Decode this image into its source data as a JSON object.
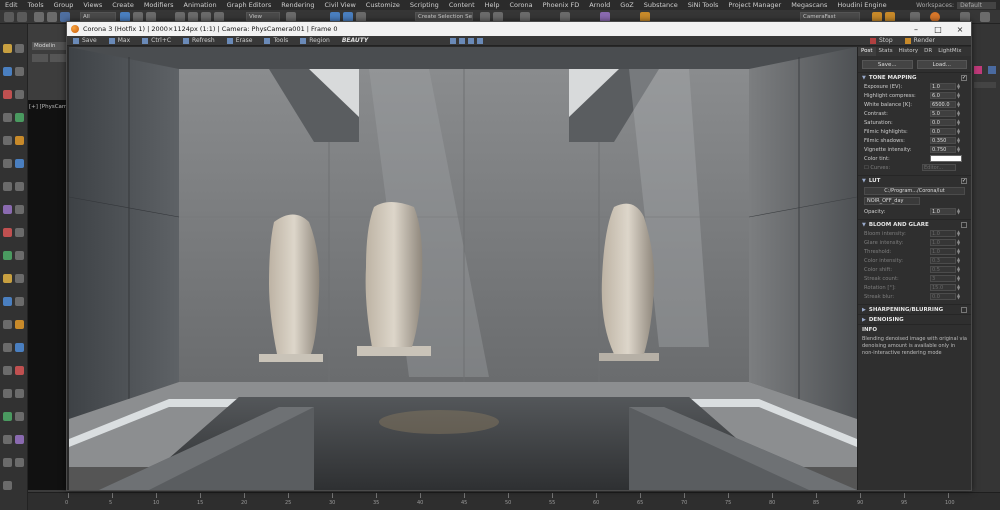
{
  "menubar": {
    "items": [
      "Edit",
      "Tools",
      "Group",
      "Views",
      "Create",
      "Modifiers",
      "Animation",
      "Graph Editors",
      "Rendering",
      "Civil View",
      "Customize",
      "Scripting",
      "Content",
      "Help",
      "Corona",
      "Phoenix FD",
      "Arnold",
      "GoZ",
      "Substance",
      "SiNi Tools",
      "Project Manager",
      "Megascans",
      "Houdini Engine"
    ],
    "workspaces_label": "Workspaces:",
    "workspaces_value": "Default"
  },
  "toolbar": {
    "filter_value": "All",
    "view_value": "View",
    "selection_set": "Create Selection Set",
    "camera_value": "CameraFast"
  },
  "left": {
    "modeling_tab": "Modelin",
    "viewport_label": "[+] [PhysCam"
  },
  "vfb": {
    "title": "Corona 3 (Hotfix 1) | 2000×1124px (1:1) | Camera: PhysCamera001 | Frame 0",
    "toolbar": [
      "Save",
      "Max",
      "Ctrl+C",
      "Refresh",
      "Erase",
      "Tools",
      "Region"
    ],
    "beauty": "BEAUTY",
    "right_toolbar": [
      "Stop",
      "Render"
    ]
  },
  "post": {
    "tabs": [
      "Post",
      "Stats",
      "History",
      "DR",
      "LightMix"
    ],
    "save_btn": "Save...",
    "load_btn": "Load...",
    "tone_mapping": {
      "title": "TONE MAPPING",
      "rows": [
        {
          "label": "Exposure (EV):",
          "value": "1.0"
        },
        {
          "label": "Highlight compress:",
          "value": "6.0"
        },
        {
          "label": "White balance [K]:",
          "value": "6500.0"
        },
        {
          "label": "Contrast:",
          "value": "5.0"
        },
        {
          "label": "Saturation:",
          "value": "0.0"
        },
        {
          "label": "Filmic highlights:",
          "value": "0.0"
        },
        {
          "label": "Filmic shadows:",
          "value": "0.350"
        },
        {
          "label": "Vignette intensity:",
          "value": "0.750"
        }
      ],
      "color_tint": "Color tint:",
      "curves": "Curves:",
      "curves_btn": "Editor..."
    },
    "lut": {
      "title": "LUT",
      "path": "C:/Program.../Corona/lut",
      "selected": "NOIR_OFF_day",
      "opacity_label": "Opacity:",
      "opacity_value": "1.0"
    },
    "bloom": {
      "title": "BLOOM AND GLARE",
      "rows": [
        {
          "label": "Bloom intensity:",
          "value": "1.0"
        },
        {
          "label": "Glare intensity:",
          "value": "1.0"
        },
        {
          "label": "Threshold:",
          "value": "1.0"
        },
        {
          "label": "Color intensity:",
          "value": "0.3"
        },
        {
          "label": "Color shift:",
          "value": "0.5"
        },
        {
          "label": "Streak count:",
          "value": "3"
        },
        {
          "label": "Rotation [°]:",
          "value": "15.0"
        },
        {
          "label": "Streak blur:",
          "value": "0.0"
        }
      ]
    },
    "sharpening_title": "SHARPENING/BLURRING",
    "denoising_title": "DENOISING",
    "info_title": "INFO",
    "info_text": "Blending denoised image with original via denoising amount is available only in non-interactive rendering mode"
  },
  "timeline": {
    "labels": [
      "0",
      "5",
      "10",
      "15",
      "20",
      "25",
      "30",
      "35",
      "40",
      "45",
      "50",
      "55",
      "60",
      "65",
      "70",
      "75",
      "80",
      "85",
      "90",
      "95",
      "100"
    ]
  }
}
